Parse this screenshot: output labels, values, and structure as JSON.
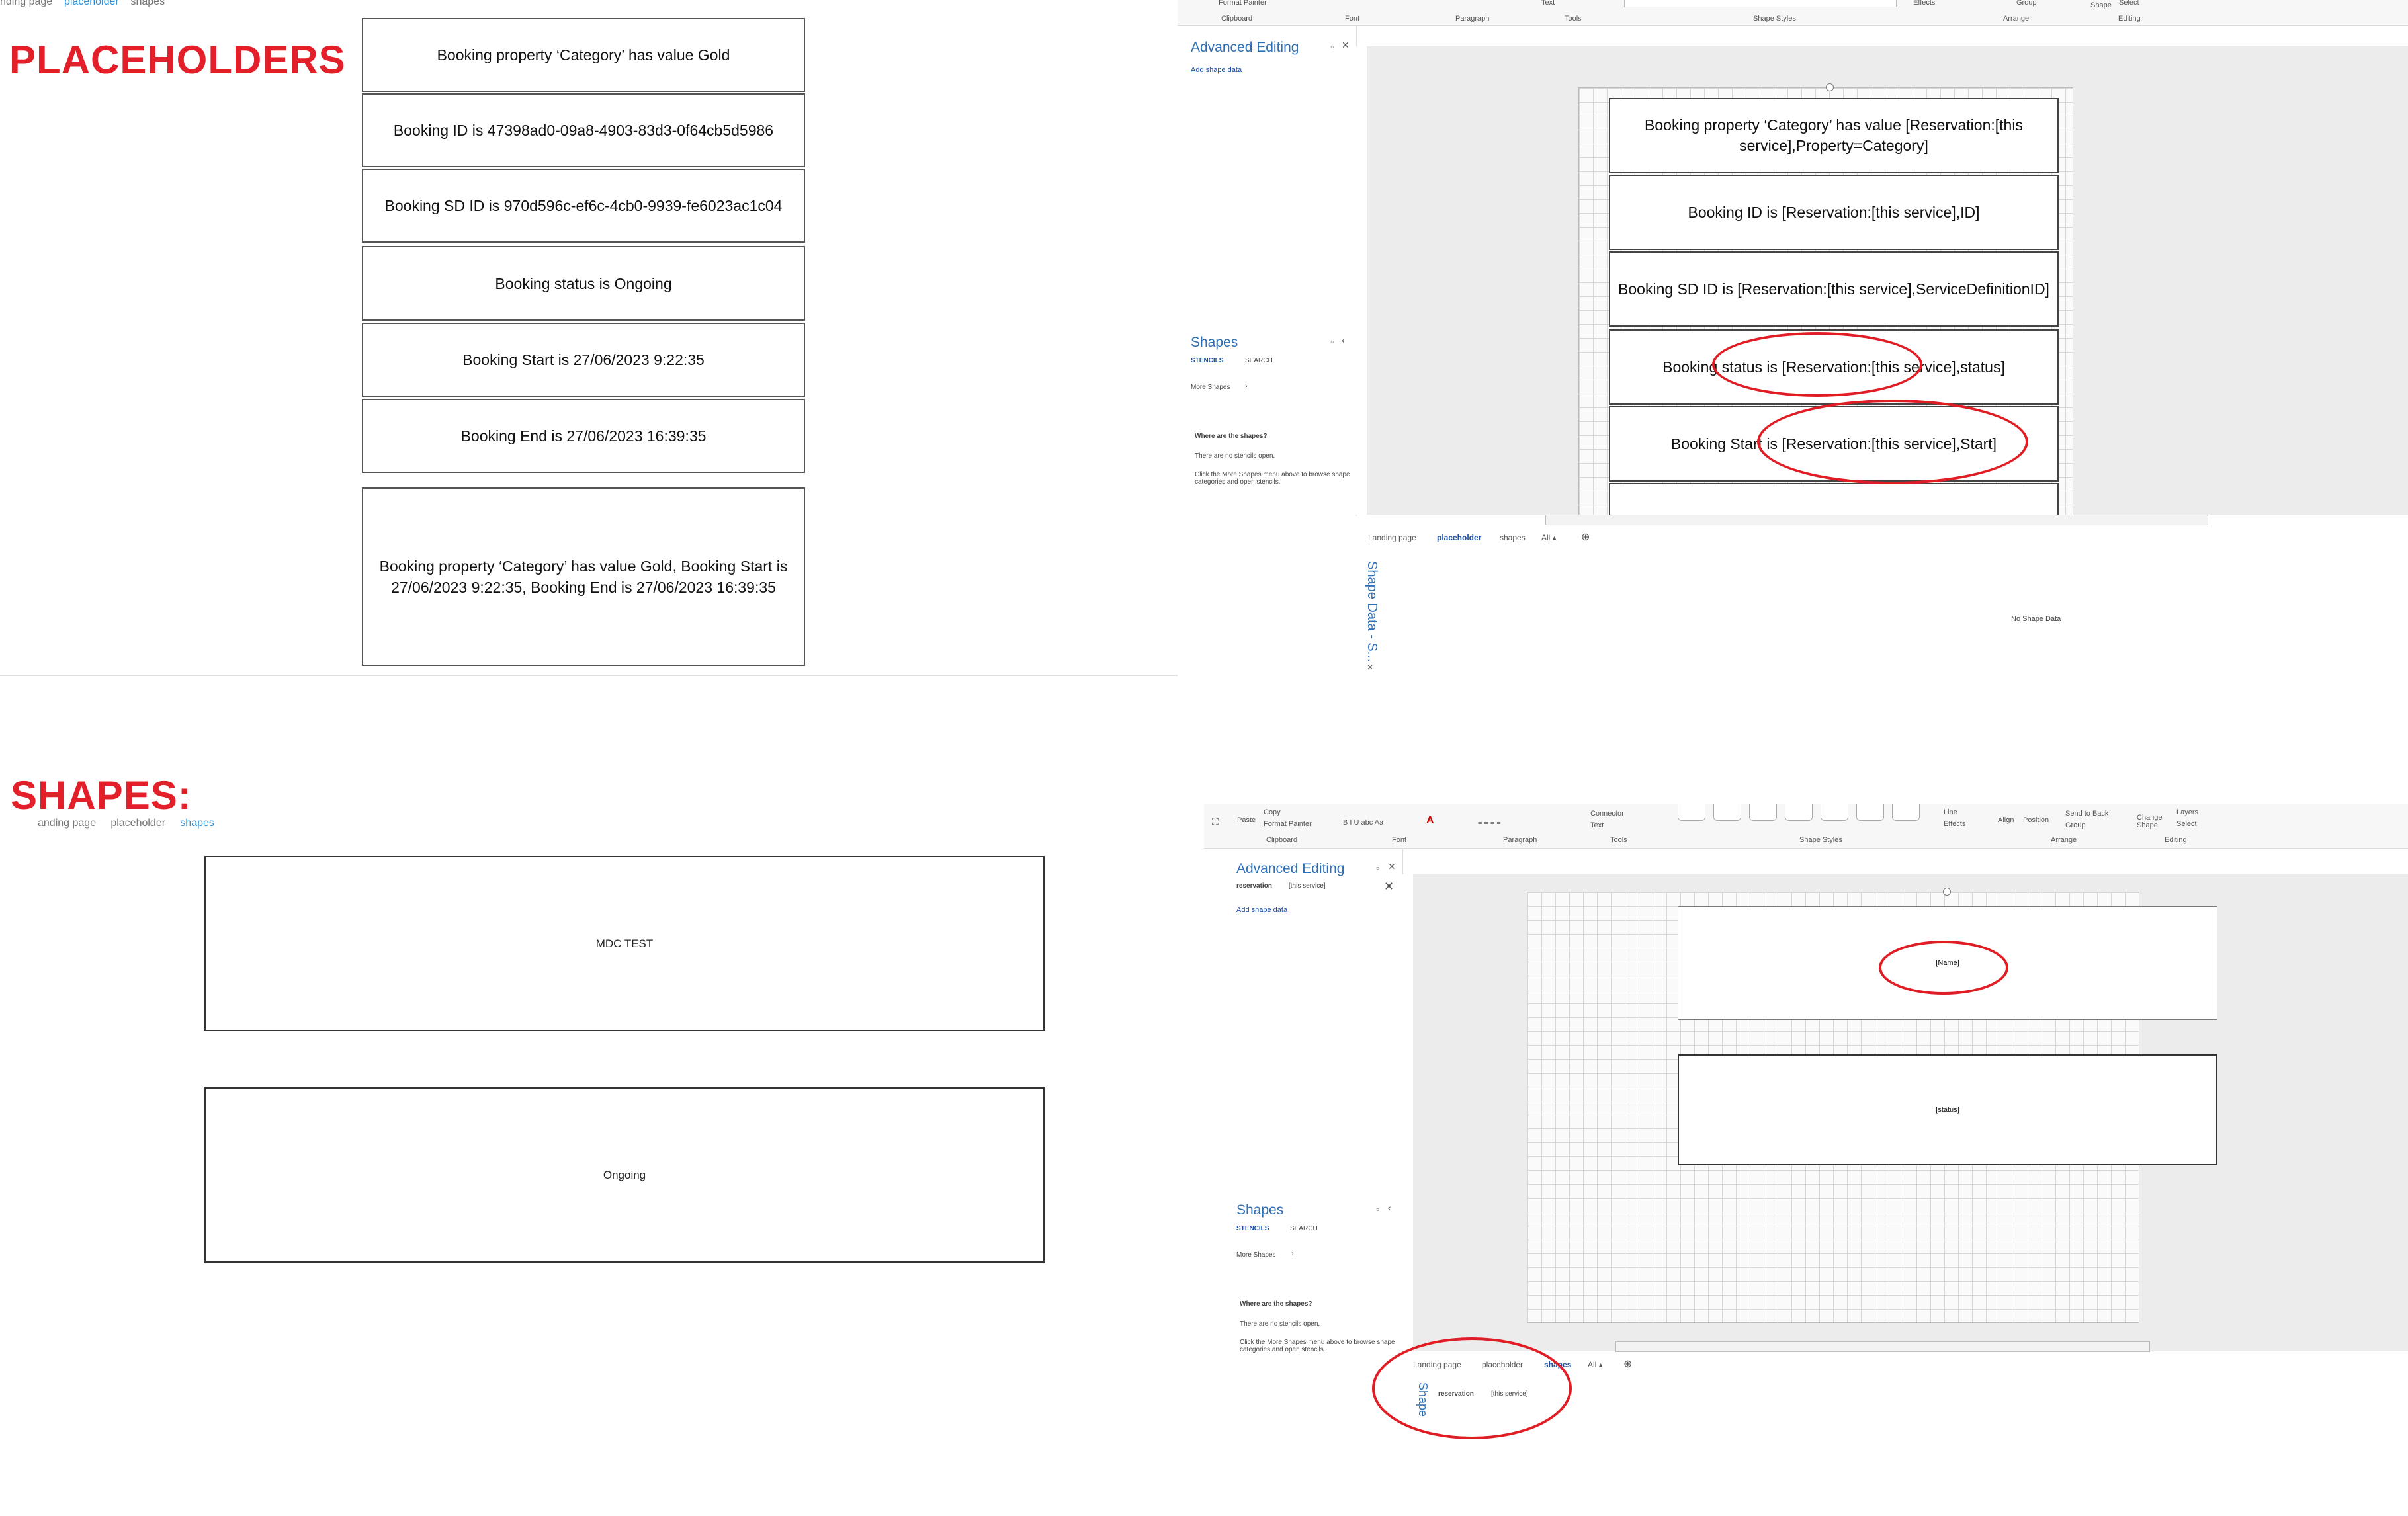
{
  "placeholders": {
    "title": "PLACEHOLDERS",
    "crumbs": [
      "nding page",
      "placeholder",
      "shapes"
    ],
    "boxes": [
      "Booking property ‘Category’ has value Gold",
      "Booking ID is 47398ad0-09a8-4903-83d3-0f64cb5d5986",
      "Booking SD ID is 970d596c-ef6c-4cb0-9939-fe6023ac1c04",
      "Booking status is Ongoing",
      "Booking Start is 27/06/2023 9:22:35",
      "Booking End is 27/06/2023 16:39:35",
      "Booking property ‘Category’ has value Gold, Booking Start is 27/06/2023 9:22:35, Booking End is 27/06/2023 16:39:35"
    ]
  },
  "shapes_section": {
    "title": "SHAPES:",
    "crumbs": [
      "anding page",
      "placeholder",
      "shapes"
    ],
    "boxes": [
      "MDC TEST",
      "Ongoing"
    ]
  },
  "visio_top": {
    "ribbon": {
      "format_painter": "Format Painter",
      "text": "Text",
      "effects": "Effects",
      "group": "Group",
      "shape": "Shape",
      "select": "Select",
      "groups": [
        "Clipboard",
        "Font",
        "Paragraph",
        "Tools",
        "Shape Styles",
        "Arrange",
        "Editing"
      ]
    },
    "advanced_editing": {
      "title": "Advanced Editing",
      "link": "Add shape data"
    },
    "shapes_pane": {
      "title": "Shapes",
      "tab_stencils": "STENCILS",
      "tab_search": "SEARCH",
      "more_shapes": "More Shapes",
      "where_title": "Where are the shapes?",
      "line1": "There are no stencils open.",
      "line2": "Click the More Shapes menu above to browse shape categories and open stencils."
    },
    "shapes_on_canvas": [
      "Booking property ‘Category’ has value [Reservation:[this service],Property=Category]",
      "Booking ID is [Reservation:[this service],ID]",
      "Booking SD ID is [Reservation:[this service],ServiceDefinitionID]",
      "Booking status is [Reservation:[this service],status]",
      "Booking Start is [Reservation:[this service],Start]"
    ],
    "page_tabs": [
      "Landing page",
      "placeholder",
      "shapes",
      "All ▴"
    ],
    "shape_data_label": "Shape Data - S...",
    "no_shape_data": "No Shape Data"
  },
  "visio_bottom": {
    "ribbon": {
      "paste": "Paste",
      "copy": "Copy",
      "format_painter": "Format Painter",
      "connector": "Connector",
      "text": "Text",
      "line": "Line",
      "effects": "Effects",
      "align": "Align",
      "position": "Position",
      "send_to_back": "Send to Back",
      "group": "Group",
      "change_shape": "Change Shape",
      "layers": "Layers",
      "select": "Select",
      "font_row": "B  I  U  abc  Aa",
      "groups": [
        "Clipboard",
        "Font",
        "Paragraph",
        "Tools",
        "Shape Styles",
        "Arrange",
        "Editing"
      ]
    },
    "advanced_editing": {
      "title": "Advanced Editing",
      "field_name": "reservation",
      "field_value": "[this service]",
      "link": "Add shape data"
    },
    "shapes_pane": {
      "title": "Shapes",
      "tab_stencils": "STENCILS",
      "tab_search": "SEARCH",
      "more_shapes": "More Shapes",
      "where_title": "Where are the shapes?",
      "line1": "There are no stencils open.",
      "line2": "Click the More Shapes menu above to browse shape categories and open stencils."
    },
    "shapes_on_canvas": [
      "[Name]",
      "[status]"
    ],
    "page_tabs": [
      "Landing page",
      "placeholder",
      "shapes",
      "All ▴"
    ],
    "shape_data_label": "Shape",
    "shape_data_name": "reservation",
    "shape_data_value": "[this service]"
  }
}
